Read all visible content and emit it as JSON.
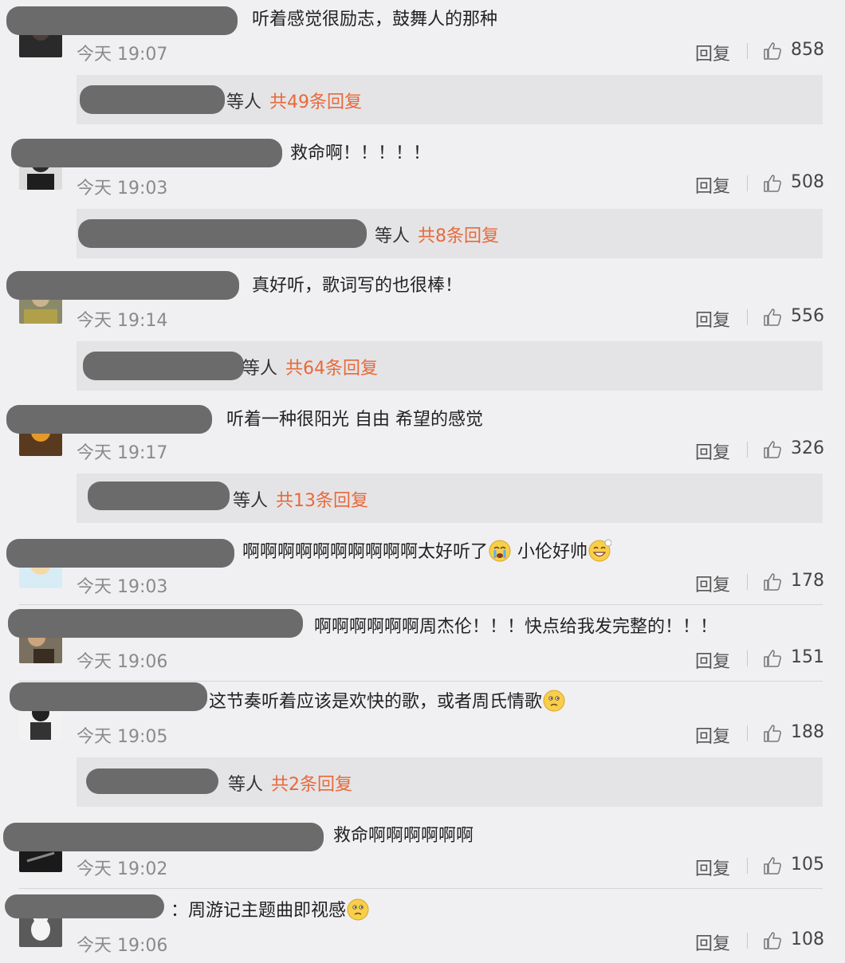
{
  "comments": [
    {
      "text": "听着感觉很励志，鼓舞人的那种",
      "time": "今天 19:07",
      "reply_label": "回复",
      "likes": "858",
      "reply_thread": {
        "suffix": "等人",
        "count": "共49条回复"
      }
    },
    {
      "text": "救命啊！！！！！",
      "time": "今天 19:03",
      "reply_label": "回复",
      "likes": "508",
      "reply_thread": {
        "suffix": "等人",
        "count": "共8条回复"
      }
    },
    {
      "text": "真好听，歌词写的也很棒！",
      "time": "今天 19:14",
      "reply_label": "回复",
      "likes": "556",
      "reply_thread": {
        "suffix": "等人",
        "count": "共64条回复"
      }
    },
    {
      "text": "听着一种很阳光 自由 希望的感觉",
      "time": "今天 19:17",
      "reply_label": "回复",
      "likes": "326",
      "reply_thread": {
        "suffix": "等人",
        "count": "共13条回复"
      }
    },
    {
      "text": "啊啊啊啊啊啊啊啊啊啊太好听了",
      "text2": "小伦好帅",
      "time": "今天 19:03",
      "reply_label": "回复",
      "likes": "178"
    },
    {
      "text": "啊啊啊啊啊啊周杰伦！！！快点给我发完整的！！！",
      "time": "今天 19:06",
      "reply_label": "回复",
      "likes": "151"
    },
    {
      "text": "这节奏听着应该是欢快的歌，或者周氏情歌",
      "time": "今天 19:05",
      "reply_label": "回复",
      "likes": "188",
      "reply_thread": {
        "suffix": "等人",
        "count": "共2条回复"
      }
    },
    {
      "text": "救命啊啊啊啊啊啊",
      "time": "今天 19:02",
      "reply_label": "回复",
      "likes": "105"
    },
    {
      "text": "：周游记主题曲即视感",
      "time": "今天 19:06",
      "reply_label": "回复",
      "likes": "108"
    }
  ],
  "colors": {
    "accent": "#e8693a",
    "background": "#f0f0f2",
    "reply_box": "#e4e4e6",
    "redaction": "#6b6b6b"
  },
  "icons": {
    "like": "thumbs-up-icon",
    "cry": "crying-emoji-icon",
    "smile": "grin-emoji-icon",
    "think": "thinking-emoji-icon"
  }
}
